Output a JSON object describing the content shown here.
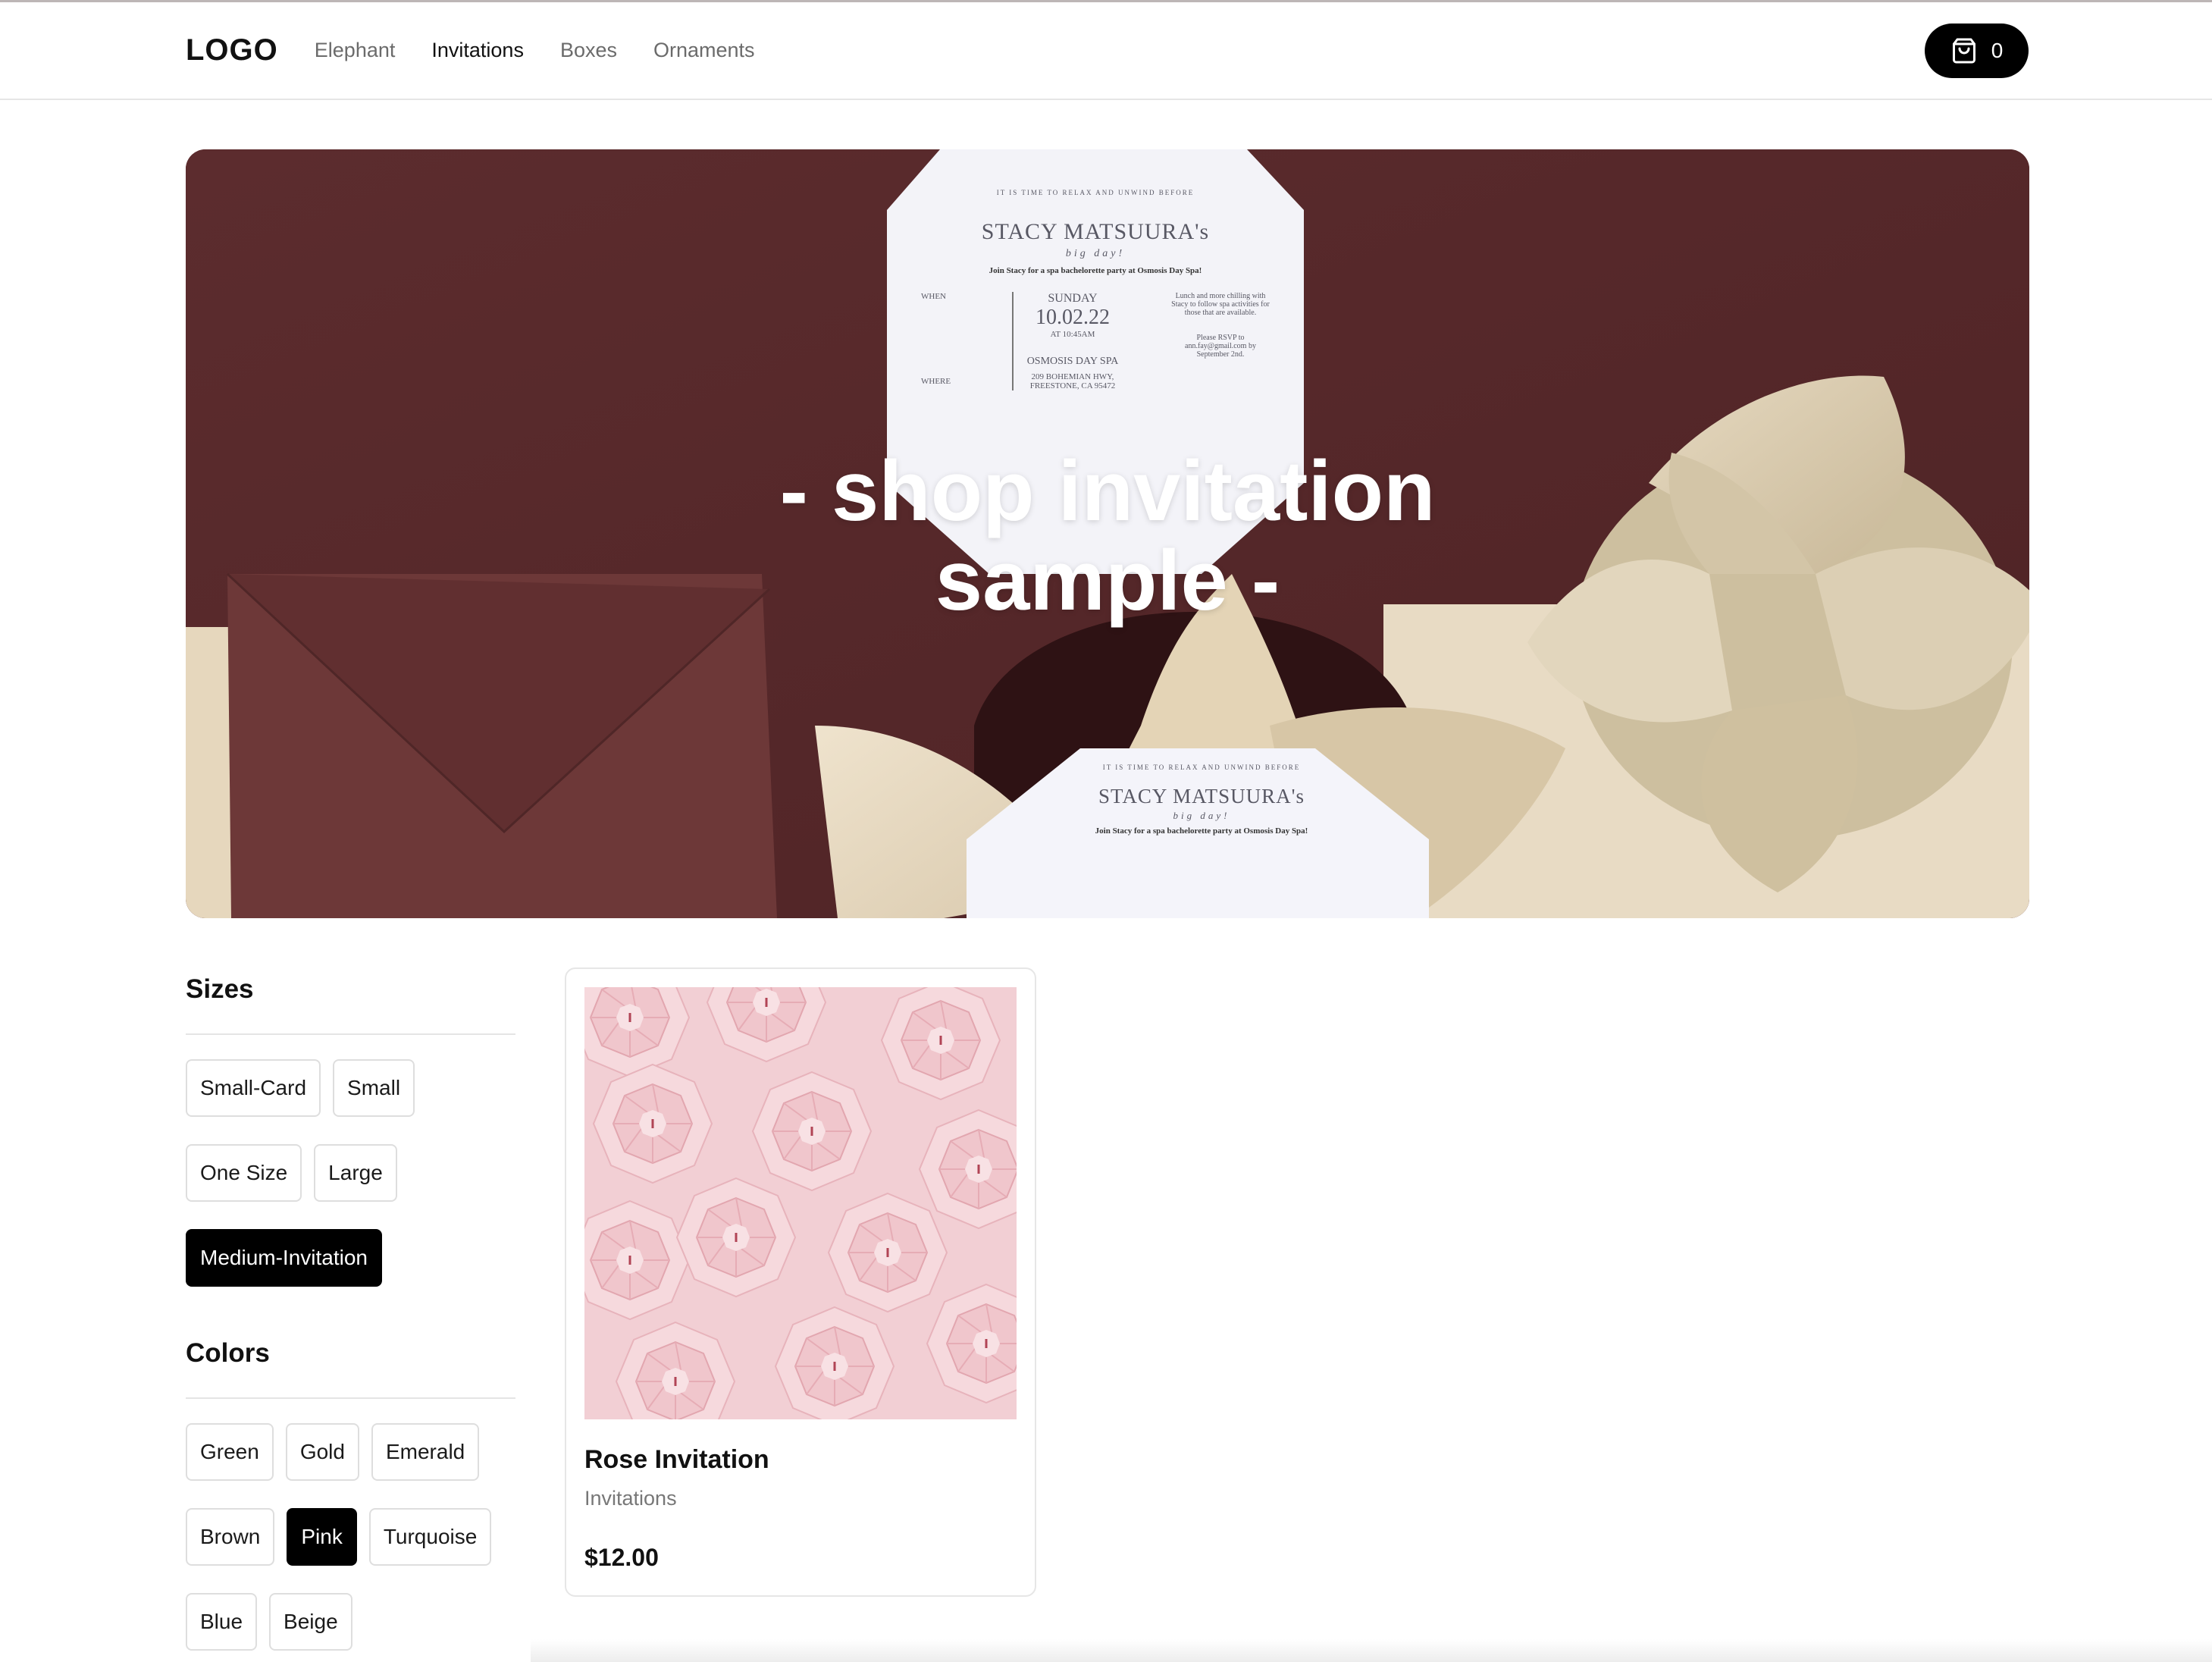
{
  "header": {
    "logo": "LOGO",
    "nav": [
      {
        "label": "Elephant",
        "active": false
      },
      {
        "label": "Invitations",
        "active": true
      },
      {
        "label": "Boxes",
        "active": false
      },
      {
        "label": "Ornaments",
        "active": false
      }
    ],
    "cart": {
      "icon": "shopping-bag-icon",
      "count": "0"
    }
  },
  "hero": {
    "line1": "- shop invitation",
    "line2": "sample -",
    "card_top": {
      "arc": "IT IS TIME TO RELAX AND UNWIND BEFORE",
      "name": "STACY MATSUURA's",
      "tagline": "big day!",
      "intro": "Join Stacy for a spa bachelorette party at Osmosis Day Spa!",
      "when_label": "WHEN",
      "day": "SUNDAY",
      "date": "10.02.22",
      "time": "AT 10:45AM",
      "where_label": "WHERE",
      "venue": "OSMOSIS DAY SPA",
      "address": "209 BOHEMIAN HWY, FREESTONE, CA 95472",
      "note": "Lunch and more chilling with Stacy to follow spa activities for those that are available.",
      "rsvp": "Please RSVP to ann.fay@gmail.com by September 2nd."
    },
    "card_bottom": {
      "arc": "IT IS TIME TO RELAX AND UNWIND BEFORE",
      "name": "STACY MATSUURA's",
      "tagline": "big day!",
      "intro": "Join Stacy for a spa bachelorette party at Osmosis Day Spa!"
    }
  },
  "filters": {
    "sizes": {
      "title": "Sizes",
      "options": [
        {
          "label": "Small-Card",
          "selected": false
        },
        {
          "label": "Small",
          "selected": false
        },
        {
          "label": "One Size",
          "selected": false
        },
        {
          "label": "Large",
          "selected": false
        },
        {
          "label": "Medium-Invitation",
          "selected": true
        }
      ]
    },
    "colors": {
      "title": "Colors",
      "options": [
        {
          "label": "Green",
          "selected": false
        },
        {
          "label": "Gold",
          "selected": false
        },
        {
          "label": "Emerald",
          "selected": false
        },
        {
          "label": "Brown",
          "selected": false
        },
        {
          "label": "Pink",
          "selected": true
        },
        {
          "label": "Turquoise",
          "selected": false
        },
        {
          "label": "Blue",
          "selected": false
        },
        {
          "label": "Beige",
          "selected": false
        }
      ]
    }
  },
  "products": [
    {
      "name": "Rose Invitation",
      "category": "Invitations",
      "price": "$12.00"
    }
  ],
  "colors": {
    "hero_wall": "#5a2b2d",
    "hero_envelope": "#6e3a3a",
    "hero_cream": "#e9dcc4",
    "product_pink": "#f2cdd2",
    "selected_chip": "#000000"
  }
}
